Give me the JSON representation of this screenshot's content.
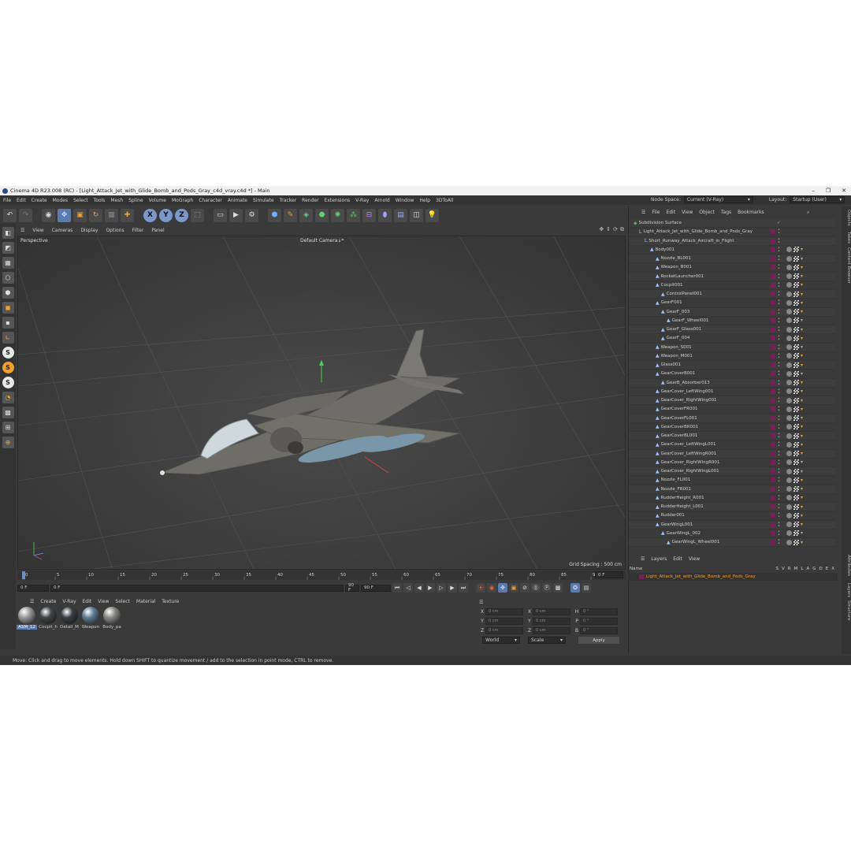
{
  "window": {
    "title": "Cinema 4D R23.008 (RC) - [Light_Attack_Jet_with_Glide_Bomb_and_Pods_Gray_c4d_vray.c4d *] - Main",
    "minimize": "–",
    "maximize": "❐",
    "close": "✕"
  },
  "menu": [
    "File",
    "Edit",
    "Create",
    "Modes",
    "Select",
    "Tools",
    "Mesh",
    "Spline",
    "Volume",
    "MoGraph",
    "Character",
    "Animate",
    "Simulate",
    "Tracker",
    "Render",
    "Extensions",
    "V-Ray",
    "Arnold",
    "Window",
    "Help",
    "3DToAll"
  ],
  "node_space": {
    "label": "Node Space:",
    "value": "Current (V-Ray)"
  },
  "layout": {
    "label": "Layout:",
    "value": "Startup (User)"
  },
  "toolbar": {
    "x": "X",
    "y": "Y",
    "z": "Z"
  },
  "viewport": {
    "menu": [
      "View",
      "Cameras",
      "Display",
      "Options",
      "Filter",
      "Panel"
    ],
    "label": "Perspective",
    "camera": "Default Camera",
    "camera_suffix": "↓*",
    "grid_spacing": "Grid Spacing : 500 cm"
  },
  "timeline": {
    "ticks": [
      "0",
      "5",
      "10",
      "15",
      "20",
      "25",
      "30",
      "35",
      "40",
      "45",
      "50",
      "55",
      "60",
      "65",
      "70",
      "75",
      "80",
      "85",
      "90"
    ],
    "current_frame_field": "0 F",
    "start_field": "0 F",
    "start_field2": "0 F",
    "end_field": "90 F",
    "end_field2": "90 F"
  },
  "material_manager": {
    "menu": [
      "Create",
      "V-Ray",
      "Edit",
      "View",
      "Select",
      "Material",
      "Texture"
    ],
    "materials": [
      {
        "label": "ASM_12",
        "color": "#9a9a9a"
      },
      {
        "label": "Cocpit_h",
        "color": "#404548"
      },
      {
        "label": "Detail_M",
        "color": "#3a3f44"
      },
      {
        "label": "Weapon",
        "color": "#5f7d92"
      },
      {
        "label": "Body_pa",
        "color": "#8a8a86"
      }
    ]
  },
  "coordinates": {
    "rows": [
      {
        "a1": "X",
        "v1": "0 cm",
        "a2": "X",
        "v2": "0 cm",
        "a3": "H",
        "v3": "0 °"
      },
      {
        "a1": "Y",
        "v1": "0 cm",
        "a2": "Y",
        "v2": "0 cm",
        "a3": "P",
        "v3": "0 °"
      },
      {
        "a1": "Z",
        "v1": "0 cm",
        "a2": "Z",
        "v2": "0 cm",
        "a3": "B",
        "v3": "0 °"
      }
    ],
    "space": "World",
    "mode": "Scale",
    "apply": "Apply"
  },
  "status": "Move: Click and drag to move elements. Hold down SHIFT to quantize movement / add to the selection in point mode, CTRL to remove.",
  "objects": {
    "menu": [
      "File",
      "Edit",
      "View",
      "Object",
      "Tags",
      "Bookmarks"
    ],
    "rows": [
      {
        "name": "Subdivision Surface",
        "depth": 0,
        "kind": "sds"
      },
      {
        "name": "Light_Attack_Jet_with_Glide_Bomb_and_Pods_Gray",
        "depth": 1,
        "kind": "null"
      },
      {
        "name": "Short_Runway_Attack_Aircraft_in_Flight",
        "depth": 2,
        "kind": "null"
      },
      {
        "name": "Body001",
        "depth": 3,
        "kind": "mesh"
      },
      {
        "name": "Nozzle_BL001",
        "depth": 4,
        "kind": "mesh"
      },
      {
        "name": "Weapon_B001",
        "depth": 4,
        "kind": "mesh"
      },
      {
        "name": "RocketLauncher001",
        "depth": 4,
        "kind": "mesh"
      },
      {
        "name": "Cocpit001",
        "depth": 4,
        "kind": "mesh"
      },
      {
        "name": "ControlPanel001",
        "depth": 5,
        "kind": "mesh"
      },
      {
        "name": "GearF001",
        "depth": 4,
        "kind": "mesh"
      },
      {
        "name": "GearF_003",
        "depth": 5,
        "kind": "mesh"
      },
      {
        "name": "GearF_Wheel001",
        "depth": 6,
        "kind": "mesh"
      },
      {
        "name": "GearF_Glass001",
        "depth": 5,
        "kind": "mesh"
      },
      {
        "name": "GearF_004",
        "depth": 5,
        "kind": "mesh"
      },
      {
        "name": "Weapon_S001",
        "depth": 4,
        "kind": "mesh"
      },
      {
        "name": "Weapon_M001",
        "depth": 4,
        "kind": "mesh"
      },
      {
        "name": "Glass001",
        "depth": 4,
        "kind": "mesh"
      },
      {
        "name": "GearCoverB001",
        "depth": 4,
        "kind": "mesh"
      },
      {
        "name": "GearB_Absorber013",
        "depth": 5,
        "kind": "mesh"
      },
      {
        "name": "GearCover_LeftWing001",
        "depth": 4,
        "kind": "mesh"
      },
      {
        "name": "GearCover_RightWing001",
        "depth": 4,
        "kind": "mesh"
      },
      {
        "name": "GearCoverFR001",
        "depth": 4,
        "kind": "mesh"
      },
      {
        "name": "GearCoverFL001",
        "depth": 4,
        "kind": "mesh"
      },
      {
        "name": "GearCoverBR001",
        "depth": 4,
        "kind": "mesh"
      },
      {
        "name": "GearCoverBL001",
        "depth": 4,
        "kind": "mesh"
      },
      {
        "name": "GearCover_LeftWingL001",
        "depth": 4,
        "kind": "mesh"
      },
      {
        "name": "GearCover_LeftWingR001",
        "depth": 4,
        "kind": "mesh"
      },
      {
        "name": "GearCover_RightWingR001",
        "depth": 4,
        "kind": "mesh"
      },
      {
        "name": "GearCover_RightWingL001",
        "depth": 4,
        "kind": "mesh"
      },
      {
        "name": "Nozzle_FL001",
        "depth": 4,
        "kind": "mesh"
      },
      {
        "name": "Nozzle_FR001",
        "depth": 4,
        "kind": "mesh"
      },
      {
        "name": "RudderHeight_R001",
        "depth": 4,
        "kind": "mesh"
      },
      {
        "name": "RudderHeight_L001",
        "depth": 4,
        "kind": "mesh"
      },
      {
        "name": "Rudder001",
        "depth": 4,
        "kind": "mesh"
      },
      {
        "name": "GearWingL001",
        "depth": 4,
        "kind": "mesh"
      },
      {
        "name": "GearWingL_002",
        "depth": 5,
        "kind": "mesh"
      },
      {
        "name": "GearWingL_Wheel001",
        "depth": 6,
        "kind": "mesh"
      }
    ]
  },
  "side_tabs": {
    "objects": "Objects",
    "takes": "Takes",
    "content_browser": "Content Browser",
    "attributes": "Attributes",
    "layers": "Layers",
    "structure": "Structure"
  },
  "layers": {
    "menu": [
      "Layers",
      "Edit",
      "View"
    ],
    "header_name": "Name",
    "columns": [
      "S",
      "V",
      "R",
      "M",
      "L",
      "A",
      "G",
      "D",
      "E",
      "X"
    ],
    "rows": [
      {
        "name": "Light_Attack_Jet_with_Glide_Bomb_and_Pods_Gray",
        "color": "#7a1f55"
      }
    ]
  },
  "colors": {
    "accent": "#5a7ab0",
    "highlight": "#f0a030",
    "layer": "#7a1f55"
  }
}
